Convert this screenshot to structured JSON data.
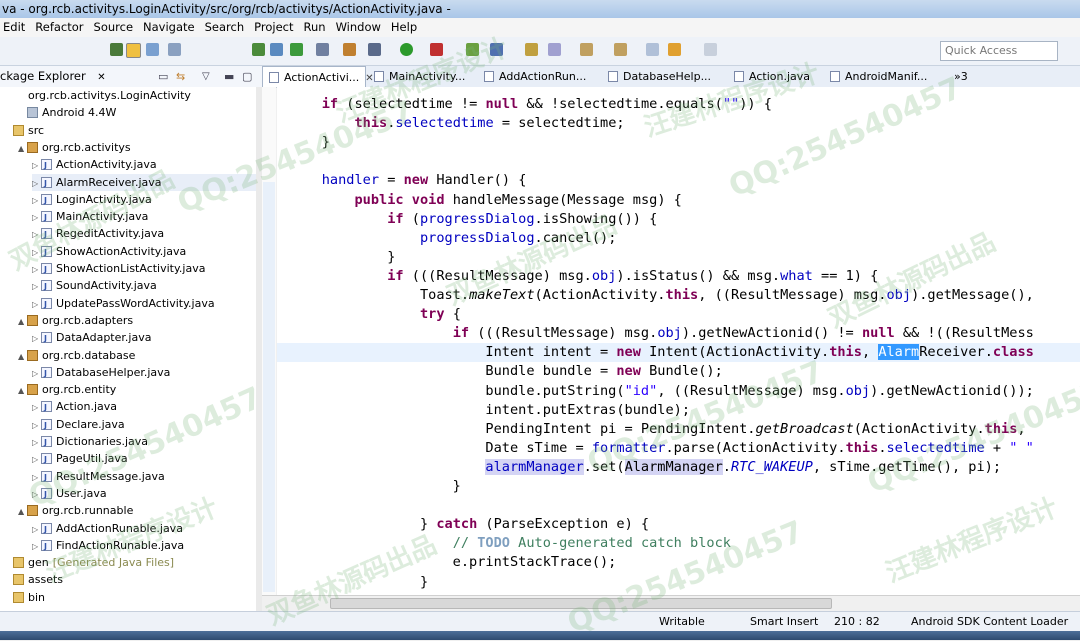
{
  "window": {
    "title": "va - org.rcb.activitys.LoginActivity/src/org/rcb/activitys/ActionActivity.java -"
  },
  "menu": [
    "Edit",
    "Refactor",
    "Source",
    "Navigate",
    "Search",
    "Project",
    "Run",
    "Window",
    "Help"
  ],
  "quick_access": {
    "placeholder": "Quick Access"
  },
  "package_explorer": {
    "title": "ckage Explorer",
    "tree": [
      {
        "label": "org.rcb.activitys.LoginActivity",
        "kind": "project",
        "level": 0,
        "tw": ""
      },
      {
        "label": "Android 4.4W",
        "kind": "lib",
        "level": 1,
        "tw": ""
      },
      {
        "label": "src",
        "kind": "folder",
        "level": 0,
        "tw": ""
      },
      {
        "label": "org.rcb.activitys",
        "kind": "pkg",
        "level": 1,
        "tw": "▲"
      },
      {
        "label": "ActionActivity.java",
        "kind": "java",
        "level": 2,
        "tw": "▷"
      },
      {
        "label": "AlarmReceiver.java",
        "kind": "java",
        "level": 2,
        "tw": "▷",
        "highlight": true
      },
      {
        "label": "LoginActivity.java",
        "kind": "java",
        "level": 2,
        "tw": "▷"
      },
      {
        "label": "MainActivity.java",
        "kind": "java",
        "level": 2,
        "tw": "▷"
      },
      {
        "label": "RegeditActivity.java",
        "kind": "java",
        "level": 2,
        "tw": "▷"
      },
      {
        "label": "ShowActionActivity.java",
        "kind": "java",
        "level": 2,
        "tw": "▷"
      },
      {
        "label": "ShowActionListActivity.java",
        "kind": "java",
        "level": 2,
        "tw": "▷"
      },
      {
        "label": "SoundActivity.java",
        "kind": "java",
        "level": 2,
        "tw": "▷"
      },
      {
        "label": "UpdatePassWordActivity.java",
        "kind": "java",
        "level": 2,
        "tw": "▷"
      },
      {
        "label": "org.rcb.adapters",
        "kind": "pkg",
        "level": 1,
        "tw": "▲"
      },
      {
        "label": "DataAdapter.java",
        "kind": "java",
        "level": 2,
        "tw": "▷"
      },
      {
        "label": "org.rcb.database",
        "kind": "pkg",
        "level": 1,
        "tw": "▲"
      },
      {
        "label": "DatabaseHelper.java",
        "kind": "java",
        "level": 2,
        "tw": "▷"
      },
      {
        "label": "org.rcb.entity",
        "kind": "pkg",
        "level": 1,
        "tw": "▲"
      },
      {
        "label": "Action.java",
        "kind": "java",
        "level": 2,
        "tw": "▷"
      },
      {
        "label": "Declare.java",
        "kind": "java",
        "level": 2,
        "tw": "▷"
      },
      {
        "label": "Dictionaries.java",
        "kind": "java",
        "level": 2,
        "tw": "▷"
      },
      {
        "label": "PageUtil.java",
        "kind": "java",
        "level": 2,
        "tw": "▷"
      },
      {
        "label": "ResultMessage.java",
        "kind": "java",
        "level": 2,
        "tw": "▷"
      },
      {
        "label": "User.java",
        "kind": "java",
        "level": 2,
        "tw": "▷"
      },
      {
        "label": "org.rcb.runnable",
        "kind": "pkg",
        "level": 1,
        "tw": "▲"
      },
      {
        "label": "AddActionRunable.java",
        "kind": "java",
        "level": 2,
        "tw": "▷"
      },
      {
        "label": "FindActionRunable.java",
        "kind": "java",
        "level": 2,
        "tw": "▷"
      },
      {
        "label": "gen",
        "suffix": "[Generated Java Files]",
        "kind": "folder",
        "level": 0,
        "tw": ""
      },
      {
        "label": "assets",
        "kind": "folder",
        "level": 0,
        "tw": ""
      },
      {
        "label": "bin",
        "kind": "folder",
        "level": 0,
        "tw": ""
      }
    ]
  },
  "editor_tabs": [
    {
      "label": "ActionActivi...",
      "active": true
    },
    {
      "label": "MainActivity..."
    },
    {
      "label": "AddActionRun..."
    },
    {
      "label": "DatabaseHelp..."
    },
    {
      "label": "Action.java"
    },
    {
      "label": "AndroidManif..."
    },
    {
      "label": "»3"
    }
  ],
  "code_lines": [
    [
      {
        "t": "    "
      },
      {
        "t": "if",
        "c": "kw"
      },
      {
        "t": " (selectedtime != "
      },
      {
        "t": "null",
        "c": "kw"
      },
      {
        "t": " && !selectedtime.equals("
      },
      {
        "t": "\"\"",
        "c": "str"
      },
      {
        "t": ")) {"
      }
    ],
    [
      {
        "t": "        "
      },
      {
        "t": "this",
        "c": "kw"
      },
      {
        "t": "."
      },
      {
        "t": "selectedtime",
        "c": "fld"
      },
      {
        "t": " = selectedtime;"
      }
    ],
    [
      {
        "t": "    }"
      }
    ],
    [
      {
        "t": ""
      }
    ],
    [
      {
        "t": "    "
      },
      {
        "t": "handler",
        "c": "fld"
      },
      {
        "t": " = "
      },
      {
        "t": "new",
        "c": "kw"
      },
      {
        "t": " Handler() {"
      }
    ],
    [
      {
        "t": "        "
      },
      {
        "t": "public",
        "c": "kw"
      },
      {
        "t": " "
      },
      {
        "t": "void",
        "c": "kw"
      },
      {
        "t": " handleMessage(Message msg) {"
      }
    ],
    [
      {
        "t": "            "
      },
      {
        "t": "if",
        "c": "kw"
      },
      {
        "t": " ("
      },
      {
        "t": "progressDialog",
        "c": "fld"
      },
      {
        "t": ".isShowing()) {"
      }
    ],
    [
      {
        "t": "                "
      },
      {
        "t": "progressDialog",
        "c": "fld"
      },
      {
        "t": ".cancel();"
      }
    ],
    [
      {
        "t": "            }"
      }
    ],
    [
      {
        "t": "            "
      },
      {
        "t": "if",
        "c": "kw"
      },
      {
        "t": " (((ResultMessage) msg."
      },
      {
        "t": "obj",
        "c": "fld"
      },
      {
        "t": ").isStatus() && msg."
      },
      {
        "t": "what",
        "c": "fld"
      },
      {
        "t": " == 1) {"
      }
    ],
    [
      {
        "t": "                Toast."
      },
      {
        "t": "makeText",
        "c": "it"
      },
      {
        "t": "(ActionActivity."
      },
      {
        "t": "this",
        "c": "kw"
      },
      {
        "t": ", ((ResultMessage) msg."
      },
      {
        "t": "obj",
        "c": "fld"
      },
      {
        "t": ").getMessage(),"
      }
    ],
    [
      {
        "t": "                "
      },
      {
        "t": "try",
        "c": "kw"
      },
      {
        "t": " {"
      }
    ],
    [
      {
        "t": "                    "
      },
      {
        "t": "if",
        "c": "kw"
      },
      {
        "t": " (((ResultMessage) msg."
      },
      {
        "t": "obj",
        "c": "fld"
      },
      {
        "t": ").getNewActionid() != "
      },
      {
        "t": "null",
        "c": "kw"
      },
      {
        "t": " && !((ResultMess"
      }
    ],
    [
      {
        "t": "                        Intent intent = "
      },
      {
        "t": "new",
        "c": "kw"
      },
      {
        "t": " Intent(ActionActivity."
      },
      {
        "t": "this",
        "c": "kw"
      },
      {
        "t": ", "
      },
      {
        "t": "Alarm",
        "c": "sel"
      },
      {
        "t": "Receiver."
      },
      {
        "t": "class",
        "c": "kw"
      }
    ],
    [
      {
        "t": "                        Bundle bundle = "
      },
      {
        "t": "new",
        "c": "kw"
      },
      {
        "t": " Bundle();"
      }
    ],
    [
      {
        "t": "                        bundle.putString("
      },
      {
        "t": "\"id\"",
        "c": "str"
      },
      {
        "t": ", ((ResultMessage) msg."
      },
      {
        "t": "obj",
        "c": "fld"
      },
      {
        "t": ").getNewActionid());"
      }
    ],
    [
      {
        "t": "                        intent.putExtras(bundle);"
      }
    ],
    [
      {
        "t": "                        PendingIntent pi = PendingIntent."
      },
      {
        "t": "getBroadcast",
        "c": "it"
      },
      {
        "t": "(ActionActivity."
      },
      {
        "t": "this",
        "c": "kw"
      },
      {
        "t": ", "
      }
    ],
    [
      {
        "t": "                        Date sTime = "
      },
      {
        "t": "formatter",
        "c": "fld"
      },
      {
        "t": ".parse(ActionActivity."
      },
      {
        "t": "this",
        "c": "kw"
      },
      {
        "t": "."
      },
      {
        "t": "selectedtime",
        "c": "fld"
      },
      {
        "t": " + "
      },
      {
        "t": "\" \"",
        "c": "str"
      }
    ],
    [
      {
        "t": "                        "
      },
      {
        "t": "alarmManager",
        "c": "fld occ"
      },
      {
        "t": ".set("
      },
      {
        "t": "AlarmManager",
        "c": "occ"
      },
      {
        "t": "."
      },
      {
        "t": "RTC_WAKEUP",
        "c": "itf"
      },
      {
        "t": ", sTime.getTime(), pi);"
      }
    ],
    [
      {
        "t": "                    }"
      }
    ],
    [
      {
        "t": ""
      }
    ],
    [
      {
        "t": "                } "
      },
      {
        "t": "catch",
        "c": "kw"
      },
      {
        "t": " (ParseException e) {"
      }
    ],
    [
      {
        "t": "                    "
      },
      {
        "t": "// ",
        "c": "cmt"
      },
      {
        "t": "TODO",
        "c": "todo"
      },
      {
        "t": " Auto-generated catch block",
        "c": "cmt"
      }
    ],
    [
      {
        "t": "                    e.printStackTrace();"
      }
    ],
    [
      {
        "t": "                }"
      }
    ]
  ],
  "status_bar": {
    "writable": "Writable",
    "insert_mode": "Smart Insert",
    "position": "210 : 82",
    "loader": "Android SDK Content Loader"
  },
  "watermarks": [
    "双鱼林源码出品",
    "QQ:254540457",
    "汪建林程序设计"
  ]
}
